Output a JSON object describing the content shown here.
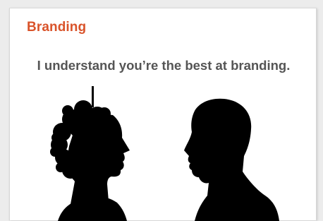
{
  "slide": {
    "title": "Branding",
    "caption": "I understand you’re the best at branding.",
    "accent_color": "#d9532a",
    "text_color": "#555555",
    "illustration": [
      "woman-silhouette",
      "man-silhouette"
    ]
  }
}
